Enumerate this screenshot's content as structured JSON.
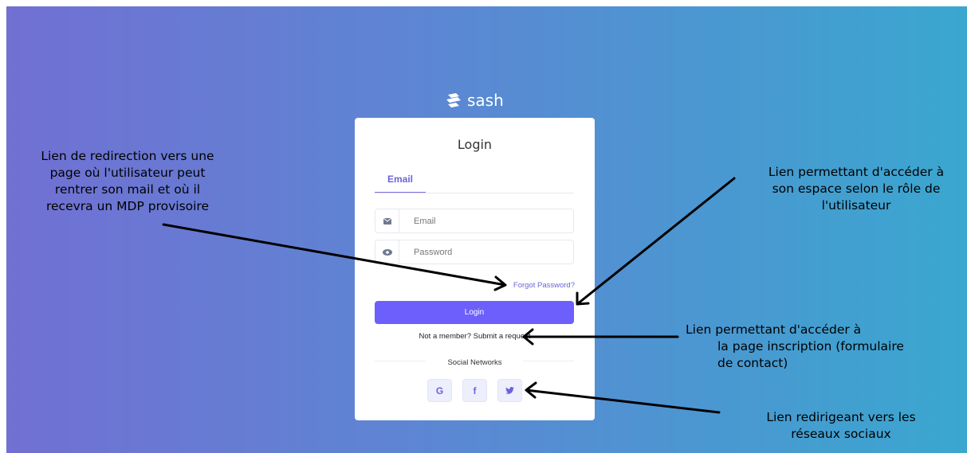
{
  "app": {
    "brand_name": "sash"
  },
  "login_card": {
    "title": "Login",
    "tabs": [
      {
        "label": "Email",
        "active": true
      }
    ],
    "email_field": {
      "placeholder": "Email",
      "value": ""
    },
    "password_field": {
      "placeholder": "Password",
      "value": ""
    },
    "forgot_password_label": "Forgot Password?",
    "login_button_label": "Login",
    "signup_text": "Not a member? Submit a request",
    "social_heading": "Social Networks",
    "social_buttons": [
      {
        "icon": "google-icon",
        "glyph": "G"
      },
      {
        "icon": "facebook-icon",
        "glyph": "f"
      },
      {
        "icon": "twitter-icon",
        "glyph": ""
      }
    ]
  },
  "annotations": {
    "forgot_note": [
      "Lien de redirection vers une",
      "page où l'utilisateur peut",
      "rentrer son mail et où il",
      "recevra un MDP provisoire"
    ],
    "login_note": [
      "Lien permettant d'accéder à",
      "son espace selon le rôle de",
      "l'utilisateur"
    ],
    "signup_note": [
      "Lien permettant d'accéder à",
      "la page inscription (formulaire",
      "de contact)"
    ],
    "social_note": [
      "Lien redirigeant vers les",
      "réseaux sociaux"
    ]
  },
  "colors": {
    "gradient_start": "#7170d3",
    "gradient_end": "#3aa7cf",
    "accent": "#6c5ffc",
    "link": "#6c63d9"
  }
}
